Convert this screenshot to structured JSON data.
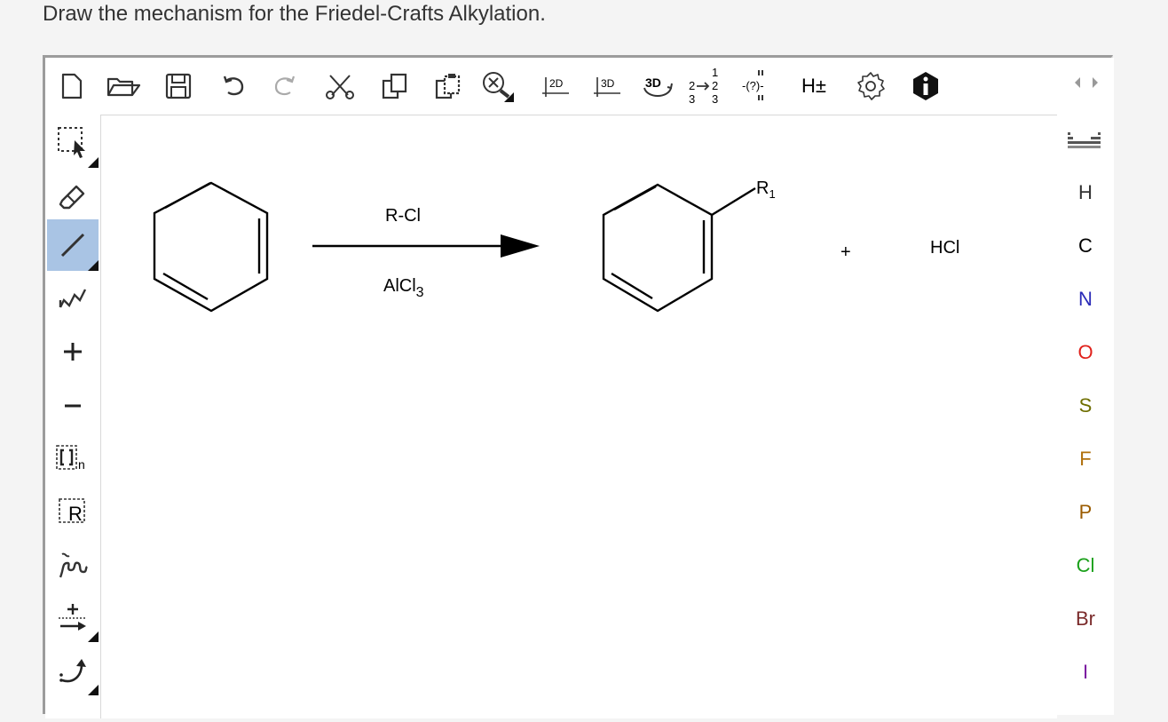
{
  "prompt": "Draw the mechanism for the Friedel-Crafts Alkylation.",
  "toolbar": {
    "view_2d": "2D",
    "view_3d": "3D",
    "view_3d_rotate": "3D",
    "renumber_top": "1",
    "renumber_mid_left": "2",
    "renumber_mid_right": "2",
    "renumber_bottom": "3",
    "stereo": "-(?)-",
    "hydrogens": "H±"
  },
  "left_tools": {
    "chain_label": "n",
    "rgroup_label": "R"
  },
  "reaction": {
    "reagent_top": "R-Cl",
    "reagent_bottom_main": "AlCl",
    "reagent_bottom_sub": "3",
    "product_substituent": "R",
    "product_substituent_sub": "1",
    "plus": "+",
    "byproduct": "HCl"
  },
  "elements": [
    {
      "symbol": "H",
      "color": "#333333"
    },
    {
      "symbol": "C",
      "color": "#000000"
    },
    {
      "symbol": "N",
      "color": "#2b2bb8"
    },
    {
      "symbol": "O",
      "color": "#e0201a"
    },
    {
      "symbol": "S",
      "color": "#6e6e00"
    },
    {
      "symbol": "F",
      "color": "#b0700d"
    },
    {
      "symbol": "P",
      "color": "#9a5b00"
    },
    {
      "symbol": "Cl",
      "color": "#1aa01a"
    },
    {
      "symbol": "Br",
      "color": "#7a2a2a"
    },
    {
      "symbol": "I",
      "color": "#7a1aa0"
    }
  ],
  "colors": {
    "active_tool_bg": "#a9c4e4",
    "editor_border": "#9c9c9c"
  }
}
